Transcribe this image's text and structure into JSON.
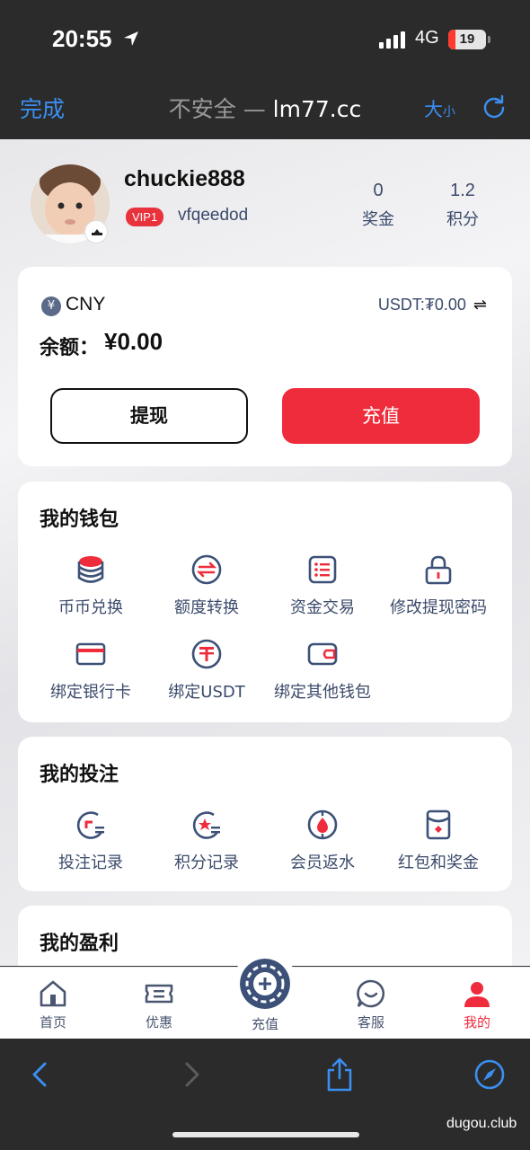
{
  "status_bar": {
    "time": "20:55",
    "network": "4G",
    "battery": "19",
    "battery_level_percent": 19
  },
  "browser": {
    "done_label": "完成",
    "insecure_label": "不安全 — ",
    "domain": "lm77.cc",
    "text_size_label": "大",
    "text_size_small": "小"
  },
  "profile": {
    "username": "chuckie888",
    "vip_badge": "VIP1",
    "nickname": "vfqeedod",
    "stats": [
      {
        "value": "0",
        "label": "奖金"
      },
      {
        "value": "1.2",
        "label": "积分"
      }
    ]
  },
  "balance": {
    "currency_icon": "¥",
    "currency": "CNY",
    "usdt_label": "USDT:₮0.00",
    "swap_icon": "⇌",
    "label": "余额：",
    "value": "¥0.00",
    "withdraw_label": "提现",
    "deposit_label": "充值"
  },
  "wallet": {
    "title": "我的钱包",
    "items": [
      {
        "label": "币币兑换",
        "icon": "coins-icon"
      },
      {
        "label": "额度转换",
        "icon": "transfer-icon"
      },
      {
        "label": "资金交易",
        "icon": "list-icon"
      },
      {
        "label": "修改提现密码",
        "icon": "lock-icon"
      },
      {
        "label": "绑定银行卡",
        "icon": "bank-card-icon"
      },
      {
        "label": "绑定USDT",
        "icon": "usdt-icon"
      },
      {
        "label": "绑定其他钱包",
        "icon": "wallet-icon"
      }
    ]
  },
  "bets": {
    "title": "我的投注",
    "items": [
      {
        "label": "投注记录",
        "icon": "bet-record-icon"
      },
      {
        "label": "积分记录",
        "icon": "points-record-icon"
      },
      {
        "label": "会员返水",
        "icon": "rebate-icon"
      },
      {
        "label": "红包和奖金",
        "icon": "red-envelope-icon"
      }
    ]
  },
  "profit": {
    "title": "我的盈利"
  },
  "tabbar": {
    "items": [
      {
        "label": "首页",
        "icon": "home-icon"
      },
      {
        "label": "优惠",
        "icon": "ticket-icon"
      },
      {
        "label": "充值",
        "icon": "deposit-icon"
      },
      {
        "label": "客服",
        "icon": "support-icon"
      },
      {
        "label": "我的",
        "icon": "user-icon",
        "active": true
      }
    ]
  },
  "watermark": "dugou.club",
  "colors": {
    "accent_red": "#ee2c3c",
    "ios_blue": "#3a8ff0",
    "text_dark": "#3b4a6b"
  }
}
